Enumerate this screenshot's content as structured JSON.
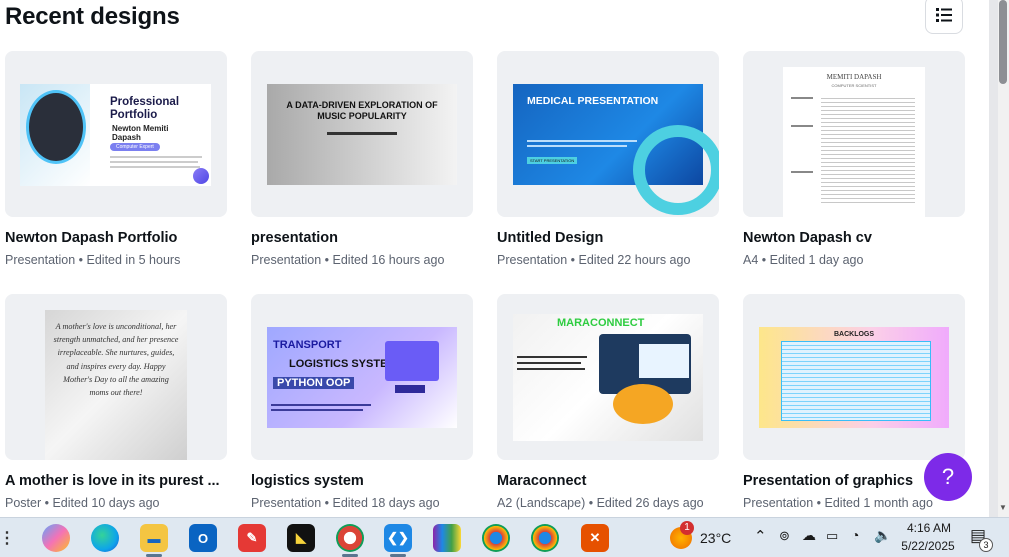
{
  "header": {
    "title": "Recent designs",
    "view_toggle_icon": "list-view-icon"
  },
  "cards": [
    {
      "title": "Newton Dapash Portfolio",
      "meta": "Presentation • Edited in 5 hours",
      "thumb": {
        "heading": "Professional Portfolio",
        "name": "Newton Memiti Dapash",
        "tag": "Computer Expert"
      }
    },
    {
      "title": "presentation",
      "meta": "Presentation • Edited 16 hours ago",
      "thumb": {
        "heading": "A DATA-DRIVEN EXPLORATION OF MUSIC POPULARITY"
      }
    },
    {
      "title": "Untitled Design",
      "meta": "Presentation • Edited 22 hours ago",
      "thumb": {
        "heading": "MEDICAL PRESENTATION",
        "button": "START PRESENTATION"
      }
    },
    {
      "title": "Newton Dapash cv",
      "meta": "A4 • Edited 1 day ago",
      "thumb": {
        "heading": "MEMITI DAPASH",
        "sub": "COMPUTER SCIENTIST"
      }
    },
    {
      "title": "A mother is love in its purest ...",
      "meta": "Poster • Edited 10 days ago",
      "thumb": {
        "text": "A mother's love is unconditional, her strength unmatched, and her presence irreplaceable. She nurtures, guides, and inspires every day. Happy Mother's Day to all the amazing moms out there!"
      }
    },
    {
      "title": "logistics system",
      "meta": "Presentation • Edited 18 days ago",
      "thumb": {
        "line1": "TRANSPORT",
        "line2": "LOGISTICS SYSTEM",
        "line3": "PYTHON OOP"
      }
    },
    {
      "title": "Maraconnect",
      "meta": "A2 (Landscape) • Edited 26 days ago",
      "thumb": {
        "heading": "MARACONNECT"
      }
    },
    {
      "title": "Presentation of graphics",
      "meta": "Presentation • Edited 1 month ago",
      "thumb": {
        "heading": "BACKLOGS"
      }
    }
  ],
  "help_button": {
    "label": "?"
  },
  "taskbar": {
    "weather": "23°C",
    "time": "4:16 AM",
    "date": "5/22/2025",
    "notif_badge": "1",
    "notif_count": "3"
  },
  "colors": {
    "accent": "#7d2ae8",
    "thumb_bg": "#eef0f3",
    "meta": "#5c6370"
  }
}
